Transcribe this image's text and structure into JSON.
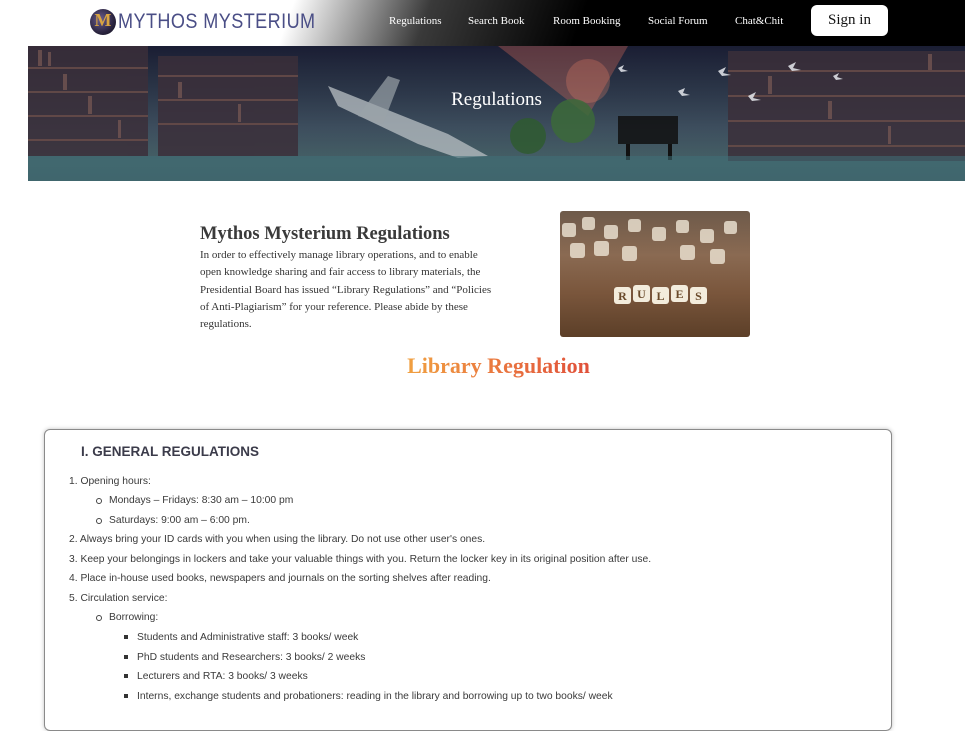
{
  "header": {
    "logo_text": "MYTHOS MYSTERIUM",
    "logo_letter": "M",
    "nav": [
      "Regulations",
      "Search Book",
      "Room Booking",
      "Social Forum",
      "Chat&Chit"
    ],
    "signin_label": "Sign in"
  },
  "banner": {
    "title": "Regulations"
  },
  "intro": {
    "title": "Mythos Mysterium Regulations",
    "lines": [
      "In order to effectively manage library operations, and to enable",
      "open knowledge sharing and fair access to library materials, the",
      "Presidential Board has issued “Library Regulations” and “Policies",
      "of Anti-Plagiarism” for your reference. Please abide by these",
      "regulations."
    ],
    "image_text": "RULES"
  },
  "library_regulation_title": "Library Regulation",
  "general": {
    "title": "I. GENERAL REGULATIONS",
    "items": [
      "1. Opening hours:",
      "Mondays – Fridays: 8:30 am – 10:00 pm",
      "Saturdays: 9:00 am – 6:00 pm.",
      "2. Always bring your ID cards with you when using the library. Do not use other user's ones.",
      "3. Keep your belongings in lockers and take your valuable things with you. Return the locker key in its original position after use.",
      "4. Place in-house used books, newspapers and journals on the sorting shelves after reading.",
      "5. Circulation service:",
      "Borrowing:",
      "Students and Administrative staff: 3 books/ week",
      "PhD students and Researchers: 3 books/ 2 weeks",
      "Lecturers and RTA: 3 books/ 3 weeks",
      "Interns, exchange students and probationers: reading in the library and borrowing up to two books/ week"
    ]
  },
  "colors": {
    "accent_orange": "#f0a040",
    "accent_red": "#e0503a",
    "logo": "#4a4e86"
  }
}
